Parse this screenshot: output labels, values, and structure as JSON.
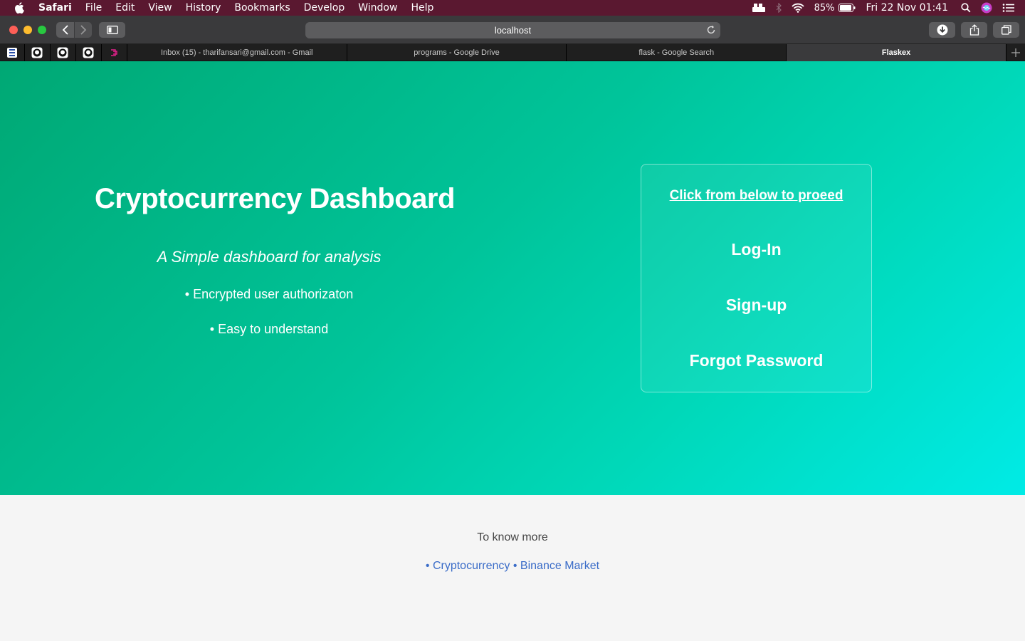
{
  "menubar": {
    "app_name": "Safari",
    "items": [
      "File",
      "Edit",
      "View",
      "History",
      "Bookmarks",
      "Develop",
      "Window",
      "Help"
    ],
    "battery": "85%",
    "clock": "Fri 22 Nov  01:41"
  },
  "toolbar": {
    "url": "localhost"
  },
  "tabs": [
    {
      "title": "Inbox (15) - tharifansari@gmail.com - Gmail",
      "active": false
    },
    {
      "title": "programs - Google Drive",
      "active": false
    },
    {
      "title": "flask - Google Search",
      "active": false
    },
    {
      "title": "Flaskex",
      "active": true
    }
  ],
  "hero": {
    "title": "Cryptocurrency Dashboard",
    "subtitle": "A Simple dashboard for analysis",
    "features": [
      "• Encrypted user authorizaton",
      "• Easy to understand"
    ]
  },
  "card": {
    "heading": "Click from below to proeed",
    "login": "Log-In",
    "signup": "Sign-up",
    "forgot": "Forgot Password"
  },
  "footer": {
    "title": "To know more",
    "links": [
      "• Cryptocurrency",
      "• Binance Market"
    ]
  },
  "colors": {
    "menubar": "#5a1830",
    "hero_gradient_start": "#00a874",
    "hero_gradient_end": "#00ebe6",
    "footer_link": "#3a6cc8"
  }
}
